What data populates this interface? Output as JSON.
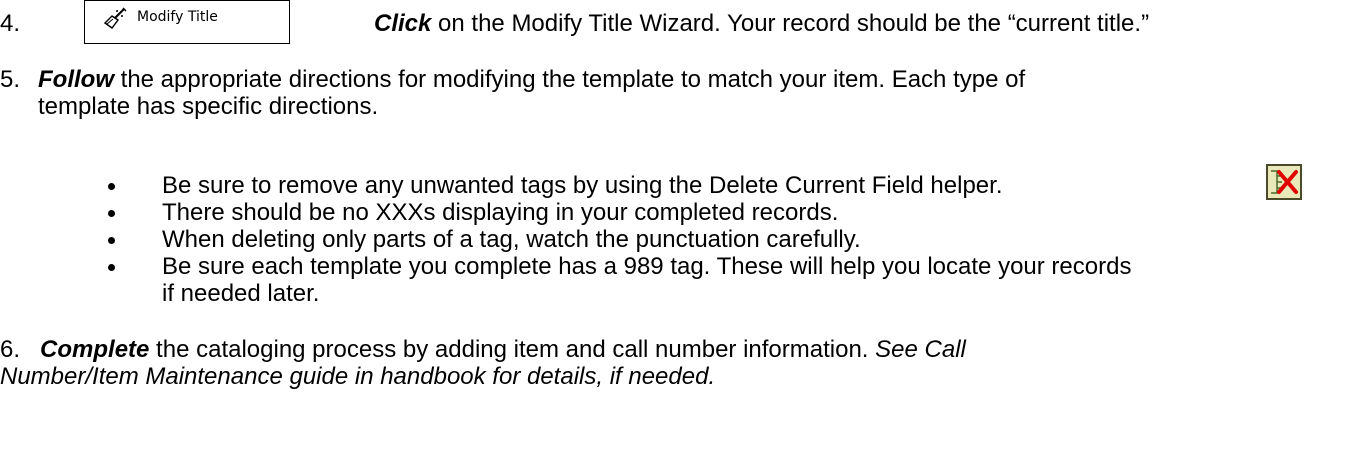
{
  "step4": {
    "number": "4.",
    "button_label": "Modify Title",
    "button_icon": "modify-wand-icon",
    "verb": "Click",
    "text": " on the Modify Title Wizard.  Your record should be the “current title.”"
  },
  "step5": {
    "number": "5.",
    "verb": "Follow",
    "line1": " the appropriate directions for modifying the template to match your item.   Each type of",
    "line2": "template has specific directions.",
    "bullets": [
      "Be sure to remove any unwanted tags by using the Delete Current Field helper.",
      "There should be no XXXs displaying in your completed records.",
      "When deleting only parts of a tag, watch the punctuation carefully.",
      "Be sure each template you complete has a 989 tag.  These will help you locate your records",
      "if needed later."
    ],
    "delete_helper_icon": "delete-current-field-icon"
  },
  "step6": {
    "number": "6.",
    "verb": "Complete",
    "line1_text": " the cataloging process by adding item and call number information.  ",
    "line1_italic": "See Call",
    "line2_italic": "Number/Item Maintenance guide in handbook for details, if needed."
  }
}
